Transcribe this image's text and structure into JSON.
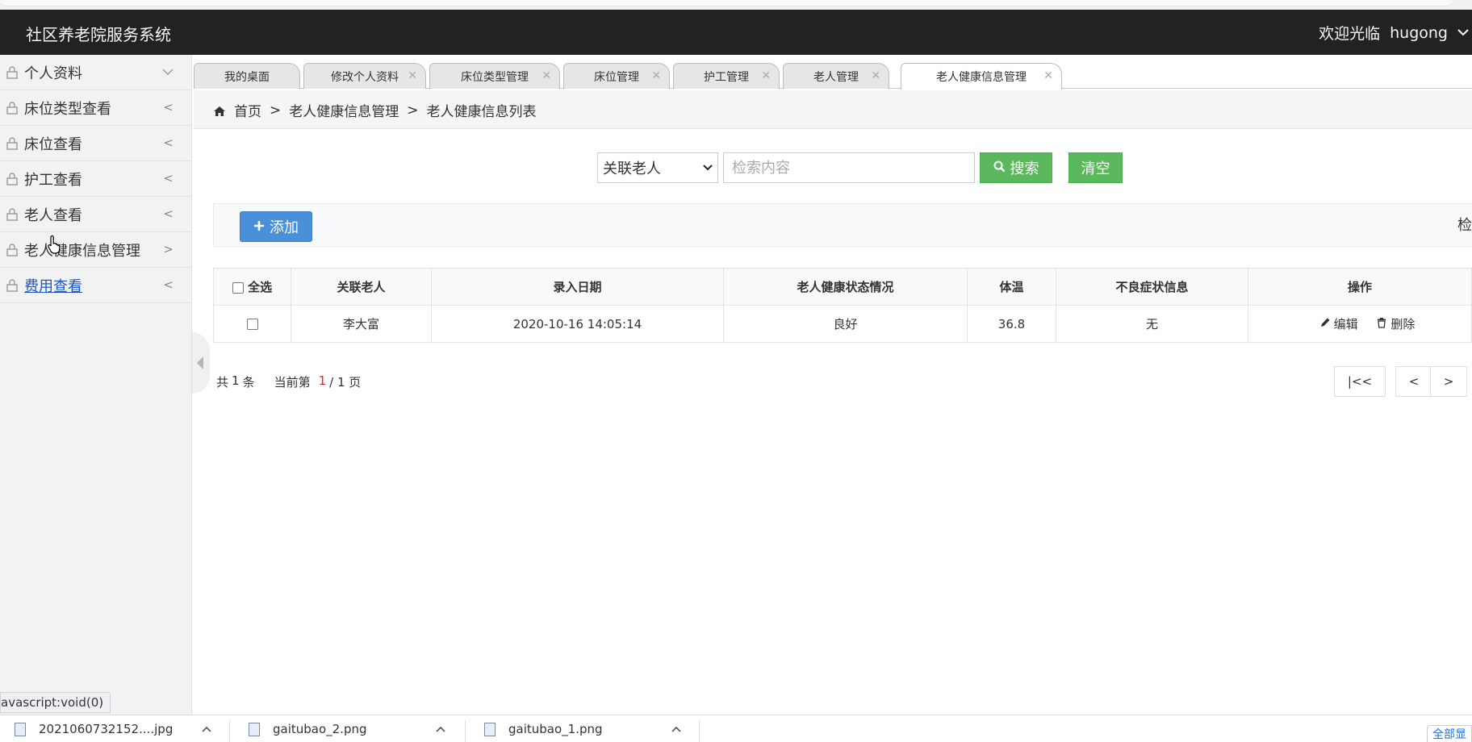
{
  "header": {
    "title": "社区养老院服务系统",
    "welcome": "欢迎光临",
    "username": "hugong"
  },
  "sidebar": {
    "items": [
      {
        "label": "个人资料",
        "arrow": "﹀"
      },
      {
        "label": "床位类型查看",
        "arrow": "<"
      },
      {
        "label": "床位查看",
        "arrow": "<"
      },
      {
        "label": "护工查看",
        "arrow": "<"
      },
      {
        "label": "老人查看",
        "arrow": "<"
      },
      {
        "label": "老人健康信息管理",
        "arrow": ">"
      },
      {
        "label": "费用查看",
        "arrow": "<"
      }
    ]
  },
  "status_tip": "avascript:void(0)",
  "tabs": [
    {
      "label": "我的桌面",
      "closable": false
    },
    {
      "label": "修改个人资料",
      "closable": true
    },
    {
      "label": "床位类型管理",
      "closable": true
    },
    {
      "label": "床位管理",
      "closable": true
    },
    {
      "label": "护工管理",
      "closable": true
    },
    {
      "label": "老人管理",
      "closable": true
    },
    {
      "label": "老人健康信息管理",
      "closable": true,
      "active": true
    }
  ],
  "breadcrumb": {
    "home": "首页",
    "sep": ">",
    "level1": "老人健康信息管理",
    "level2": "老人健康信息列表"
  },
  "search": {
    "field_selected": "关联老人",
    "placeholder": "检索内容",
    "search_label": "搜索",
    "clear_label": "清空"
  },
  "toolbar": {
    "add_label": "添加",
    "right_text": "检"
  },
  "table": {
    "select_all": "全选",
    "columns": [
      "关联老人",
      "录入日期",
      "老人健康状态情况",
      "体温",
      "不良症状信息",
      "操作"
    ],
    "rows": [
      {
        "elder": "李大富",
        "date": "2020-10-16 14:05:14",
        "status": "良好",
        "temp": "36.8",
        "symptoms": "无"
      }
    ],
    "edit_label": "编辑",
    "delete_label": "删除"
  },
  "pager": {
    "total_prefix": "共",
    "total": "1",
    "total_suffix": "条",
    "current_prefix": "当前第",
    "current": "1",
    "pages": "/ 1 页",
    "first": "|<<",
    "prev": "<",
    "next": ">"
  },
  "downloads": {
    "items": [
      "2021060732152....jpg",
      "gaitubao_2.png",
      "gaitubao_1.png"
    ],
    "show_all": "全部显"
  },
  "colors": {
    "header_bg": "#222222",
    "search_btn": "#5cb85c",
    "add_btn": "#4a90d9",
    "pager_current": "#d9252a"
  }
}
